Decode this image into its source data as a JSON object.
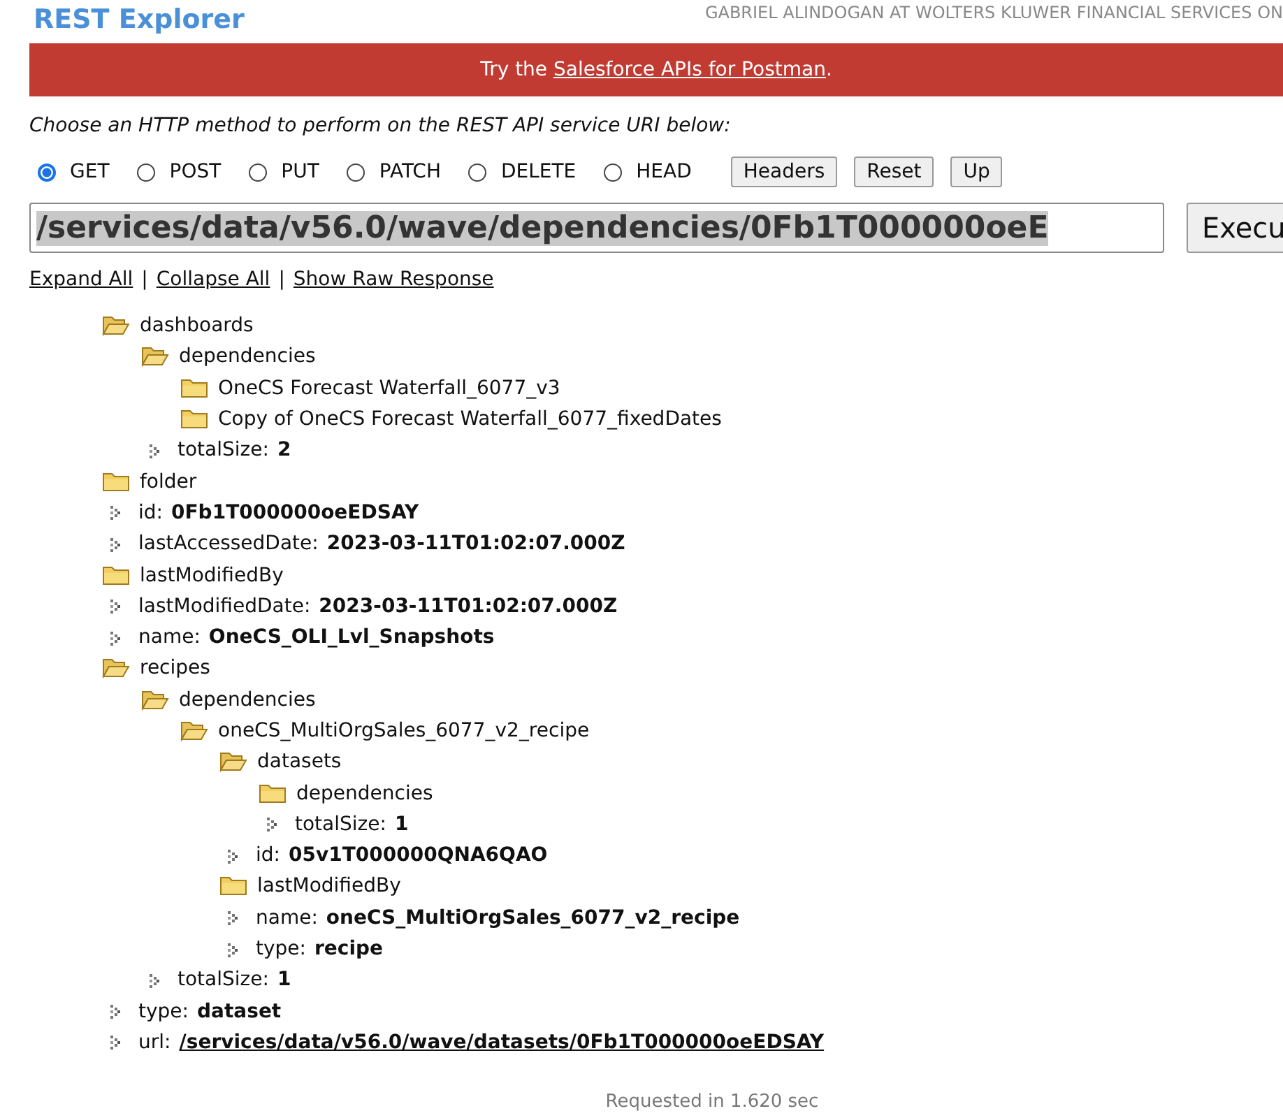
{
  "header": {
    "title": "REST Explorer",
    "user": "GABRIEL ALINDOGAN AT WOLTERS KLUWER FINANCIAL SERVICES ON"
  },
  "banner": {
    "before": "Try the ",
    "link": "Salesforce APIs for Postman",
    "after": "."
  },
  "instruction": "Choose an HTTP method to perform on the REST API service URI below:",
  "methods": [
    {
      "label": "GET",
      "selected": true
    },
    {
      "label": "POST",
      "selected": false
    },
    {
      "label": "PUT",
      "selected": false
    },
    {
      "label": "PATCH",
      "selected": false
    },
    {
      "label": "DELETE",
      "selected": false
    },
    {
      "label": "HEAD",
      "selected": false
    }
  ],
  "buttons": [
    "Headers",
    "Reset",
    "Up"
  ],
  "uri": {
    "value": "/services/data/v56.0/wave/dependencies/0Fb1T000000oeE",
    "execute": "Execu"
  },
  "links": [
    "Expand All",
    "Collapse All",
    "Show Raw Response"
  ],
  "link_separators": [
    "|",
    "|"
  ],
  "tree": [
    {
      "kind": "folder",
      "label": "dashboards",
      "expanded": true,
      "children": [
        {
          "kind": "folder",
          "label": "dependencies",
          "expanded": true,
          "children": [
            {
              "kind": "folder",
              "label": "OneCS Forecast Waterfall_6077_v3",
              "expanded": false
            },
            {
              "kind": "folder",
              "label": "Copy of OneCS Forecast Waterfall_6077_fixedDates",
              "expanded": false
            }
          ]
        },
        {
          "kind": "field",
          "key": "totalSize:",
          "value": "2"
        }
      ]
    },
    {
      "kind": "folder",
      "label": "folder",
      "expanded": false
    },
    {
      "kind": "field",
      "key": "id:",
      "value": "0Fb1T000000oeEDSAY"
    },
    {
      "kind": "field",
      "key": "lastAccessedDate:",
      "value": "2023-03-11T01:02:07.000Z"
    },
    {
      "kind": "folder",
      "label": "lastModifiedBy",
      "expanded": false
    },
    {
      "kind": "field",
      "key": "lastModifiedDate:",
      "value": "2023-03-11T01:02:07.000Z"
    },
    {
      "kind": "field",
      "key": "name:",
      "value": "OneCS_OLI_Lvl_Snapshots"
    },
    {
      "kind": "folder",
      "label": "recipes",
      "expanded": true,
      "children": [
        {
          "kind": "folder",
          "label": "dependencies",
          "expanded": true,
          "children": [
            {
              "kind": "folder",
              "label": "oneCS_MultiOrgSales_6077_v2_recipe",
              "expanded": true,
              "children": [
                {
                  "kind": "folder",
                  "label": "datasets",
                  "expanded": true,
                  "children": [
                    {
                      "kind": "folder",
                      "label": "dependencies",
                      "expanded": false
                    },
                    {
                      "kind": "field",
                      "key": "totalSize:",
                      "value": "1"
                    }
                  ]
                },
                {
                  "kind": "field",
                  "key": "id:",
                  "value": "05v1T000000QNA6QAO"
                },
                {
                  "kind": "folder",
                  "label": "lastModifiedBy",
                  "expanded": false
                },
                {
                  "kind": "field",
                  "key": "name:",
                  "value": "oneCS_MultiOrgSales_6077_v2_recipe"
                },
                {
                  "kind": "field",
                  "key": "type:",
                  "value": "recipe"
                }
              ]
            }
          ]
        },
        {
          "kind": "field",
          "key": "totalSize:",
          "value": "1"
        }
      ]
    },
    {
      "kind": "field",
      "key": "type:",
      "value": "dataset"
    },
    {
      "kind": "link",
      "key": "url:",
      "value": "/services/data/v56.0/wave/datasets/0Fb1T000000oeEDSAY"
    }
  ],
  "footer": "Requested in 1.620 sec"
}
